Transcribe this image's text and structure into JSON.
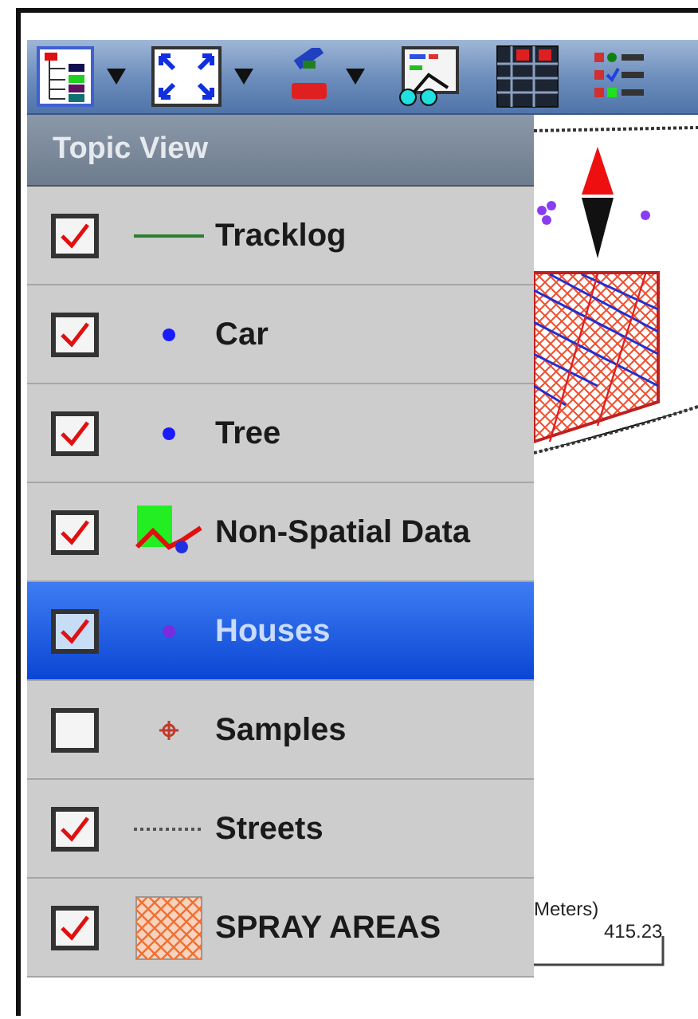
{
  "panel": {
    "title": "Topic View"
  },
  "layers": [
    {
      "label": "Tracklog",
      "kind": "line",
      "color": "#2e7d32",
      "checked": true,
      "selected": false
    },
    {
      "label": "Car",
      "kind": "dot",
      "color": "#1a1aff",
      "checked": true,
      "selected": false
    },
    {
      "label": "Tree",
      "kind": "dot",
      "color": "#1a1aff",
      "checked": true,
      "selected": false
    },
    {
      "label": "Non-Spatial Data",
      "kind": "chart",
      "checked": true,
      "selected": false
    },
    {
      "label": "Houses",
      "kind": "dot",
      "color": "#7a2be0",
      "checked": true,
      "selected": true
    },
    {
      "label": "Samples",
      "kind": "crosshair",
      "color": "#c0392b",
      "checked": false,
      "selected": false
    },
    {
      "label": "Streets",
      "kind": "dashes",
      "color": "#555555",
      "checked": true,
      "selected": false
    },
    {
      "label": "SPRAY AREAS",
      "kind": "hatch",
      "checked": true,
      "selected": false
    }
  ],
  "map": {
    "scale_unit": "Meters)",
    "scale_value": "415.23"
  }
}
